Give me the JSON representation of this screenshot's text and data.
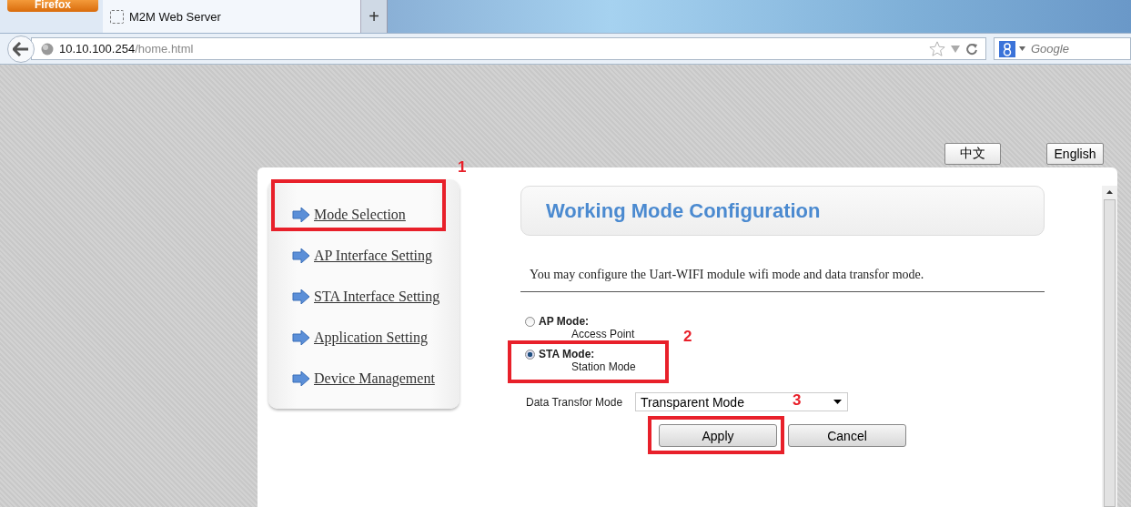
{
  "browser": {
    "menu_button": "Firefox",
    "tab": {
      "title": "M2M Web Server"
    },
    "new_tab": "+",
    "url": {
      "host": "10.10.100.254",
      "path": "/home.html"
    },
    "search": {
      "placeholder": "Google"
    }
  },
  "languages": [
    {
      "label": "中文"
    },
    {
      "label": "English"
    }
  ],
  "sidebar": {
    "items": [
      {
        "label": "Mode Selection"
      },
      {
        "label": "AP Interface Setting"
      },
      {
        "label": "STA Interface Setting"
      },
      {
        "label": "Application Setting"
      },
      {
        "label": "Device Management"
      }
    ]
  },
  "title": "Working Mode Configuration",
  "description": "You may configure the Uart-WIFI module wifi mode and data transfor mode.",
  "modes": [
    {
      "label": "AP Mode:",
      "sublabel": "Access Point",
      "selected": false
    },
    {
      "label": "STA Mode:",
      "sublabel": "Station Mode",
      "selected": true
    }
  ],
  "data_transfor": {
    "label": "Data Transfor Mode",
    "value": "Transparent Mode"
  },
  "buttons": [
    "Apply",
    "Cancel"
  ],
  "annotations": [
    {
      "number": "1"
    },
    {
      "number": "2"
    },
    {
      "number": "3"
    }
  ]
}
